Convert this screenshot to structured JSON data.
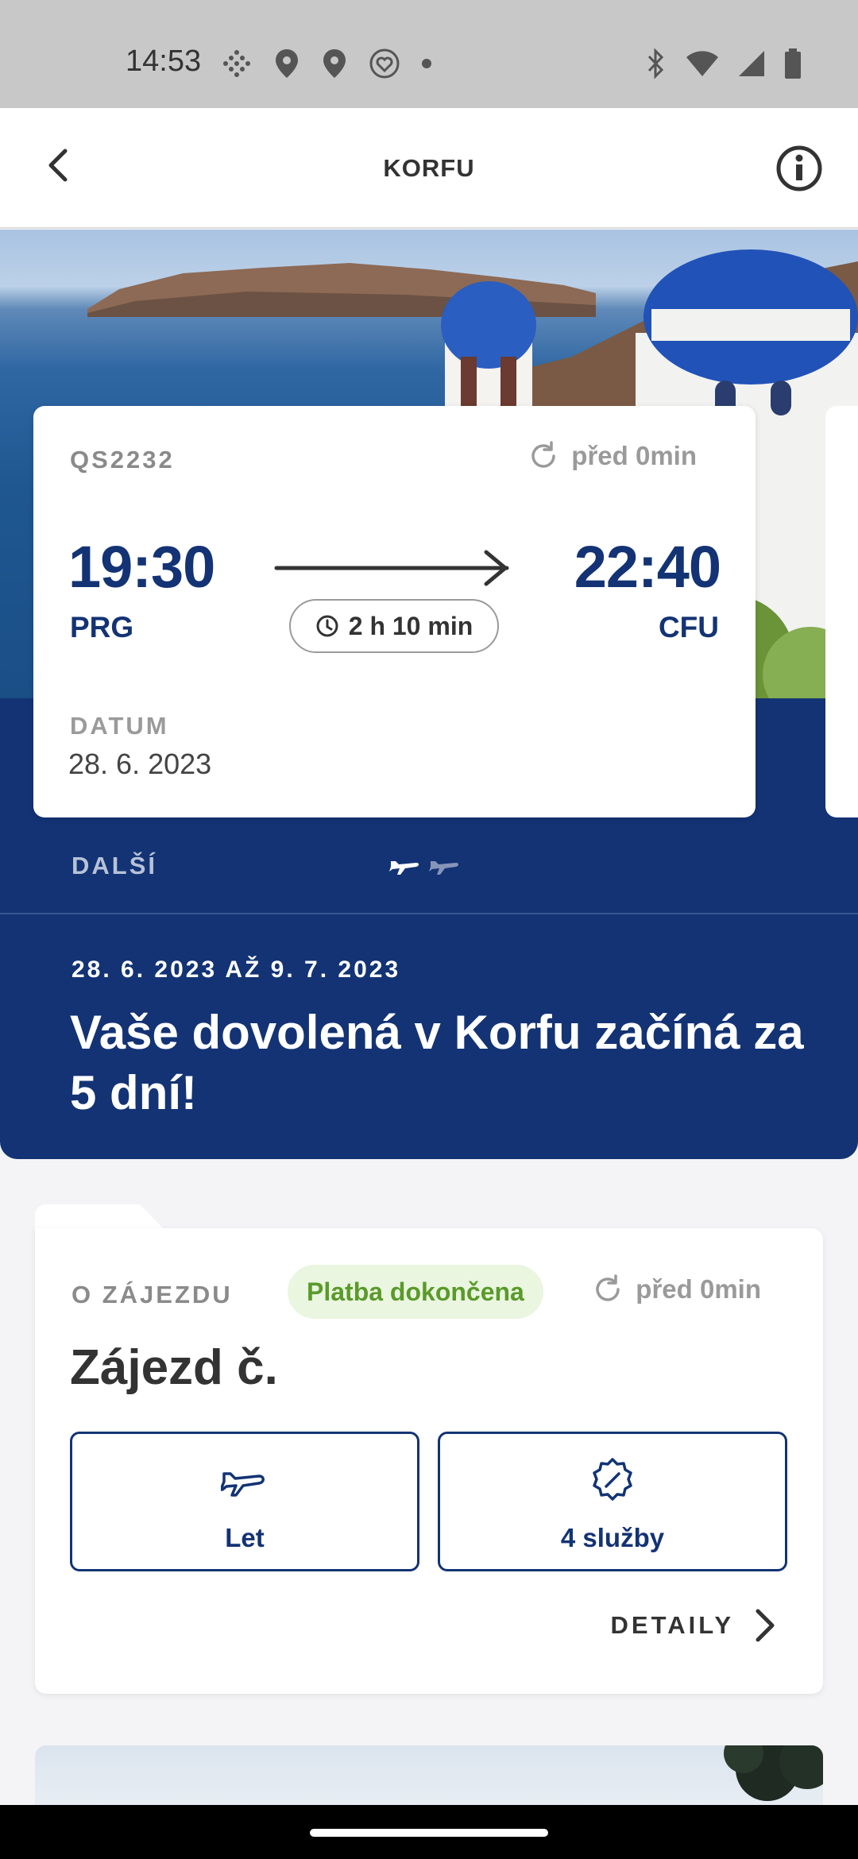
{
  "status_bar": {
    "time": "14:53",
    "left_icons": [
      "dots-grid-icon",
      "location-pin-icon",
      "location-pin-icon",
      "heart-badge-icon",
      "dot-icon"
    ],
    "right_icons": [
      "bluetooth-icon",
      "wifi-icon",
      "signal-icon",
      "battery-icon"
    ]
  },
  "app_bar": {
    "title": "KORFU",
    "back_icon": "chevron-left-icon",
    "info_icon": "info-icon"
  },
  "flight": {
    "number": "QS2232",
    "updated": "před 0min",
    "departure_time": "19:30",
    "departure_code": "PRG",
    "arrival_time": "22:40",
    "arrival_code": "CFU",
    "duration": "2 h 10 min",
    "date_label": "DATUM",
    "date_value": "28. 6. 2023"
  },
  "band": {
    "next_label": "DALŠÍ",
    "pager_count": 2,
    "pager_active": 0,
    "dates": "28. 6. 2023 AŽ 9. 7. 2023",
    "headline": "Vaše dovolená v Korfu začíná za 5 dní!"
  },
  "tour": {
    "about_label": "O ZÁJEZDU",
    "payment_status": "Platba dokončena",
    "updated": "před 0min",
    "title": "Zájezd č.",
    "flight_label": "Let",
    "services_label": "4 služby",
    "details_label": "DETAILY"
  },
  "colors": {
    "brand_navy": "#133374",
    "status_bar": "#c8c8c8",
    "payment_green": "#5a9a2a",
    "payment_bg": "#eaf6e0"
  }
}
